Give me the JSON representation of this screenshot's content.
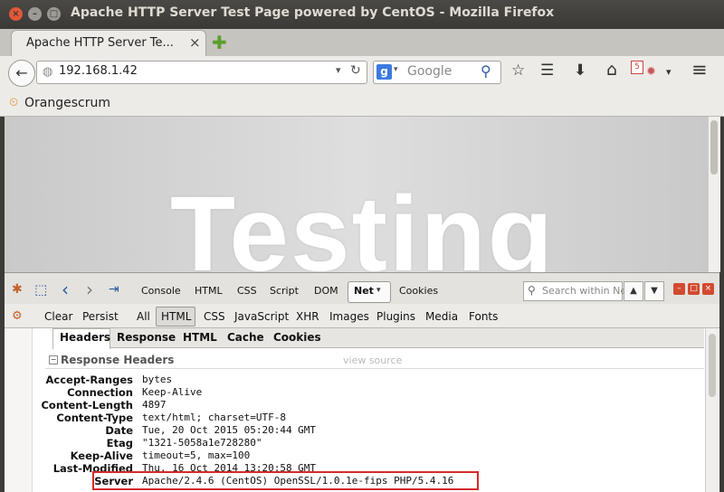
{
  "window": {
    "title": "Apache HTTP Server Test Page powered by CentOS - Mozilla Firefox",
    "controls": {
      "close": "×",
      "minimize": "–",
      "maximize": "□"
    }
  },
  "tabs": [
    {
      "label": "Apache HTTP Server Te...",
      "close": "×",
      "active": true
    }
  ],
  "new_tab": "✚",
  "navbar": {
    "back": "←",
    "url": "192.168.1.42",
    "url_dropdown": "▾",
    "reload": "↻",
    "search_engine_logo": "g",
    "search_engine_dropdown": "▾",
    "search_placeholder": "Google",
    "search_go": "⚲",
    "icons": [
      "star-icon",
      "reading-list-icon",
      "download-icon",
      "home-icon",
      "addon-icon",
      "menu-icon"
    ],
    "addon_badge": "5",
    "star": "☆",
    "reading_list": "☰",
    "download": "⬇",
    "home": "⌂",
    "addon": "▾",
    "menu": "≡"
  },
  "bookmarks": [
    {
      "label": "Orangescrum",
      "icon": "⏲"
    }
  ],
  "page": {
    "heading": "Testing"
  },
  "firebug": {
    "toolbar_glyphs": {
      "bug": "✱",
      "inspect": "⬚",
      "back": "‹",
      "forward": "›",
      "cmd": "⇥"
    },
    "tabs": [
      "Console",
      "HTML",
      "CSS",
      "Script",
      "DOM",
      "Net",
      "Cookies"
    ],
    "net_dropdown": "▾",
    "search_placeholder": "Search within Ne",
    "search_icon": "⚲",
    "nav_up": "▲",
    "nav_down": "▼",
    "win_buttons": [
      "–",
      "□",
      "×"
    ],
    "net_actions": {
      "clear": "Clear",
      "persist": "Persist"
    },
    "filters": [
      "All",
      "HTML",
      "CSS",
      "JavaScript",
      "XHR",
      "Images",
      "Plugins",
      "Media",
      "Fonts"
    ],
    "active_filter": "HTML",
    "detail_tabs": [
      "Headers",
      "Response",
      "HTML",
      "Cache",
      "Cookies"
    ],
    "active_detail_tab": "Headers",
    "section": {
      "toggle": "−",
      "title": "Response Headers",
      "view_source": "view source"
    },
    "headers": [
      {
        "name": "Accept-Ranges",
        "value": "bytes"
      },
      {
        "name": "Connection",
        "value": "Keep-Alive"
      },
      {
        "name": "Content-Length",
        "value": "4897"
      },
      {
        "name": "Content-Type",
        "value": "text/html; charset=UTF-8"
      },
      {
        "name": "Date",
        "value": "Tue, 20 Oct 2015 05:20:44 GMT"
      },
      {
        "name": "Etag",
        "value": "\"1321-5058a1e728280\""
      },
      {
        "name": "Keep-Alive",
        "value": "timeout=5, max=100"
      },
      {
        "name": "Last-Modified",
        "value": "Thu, 16 Oct 2014 13:20:58 GMT"
      },
      {
        "name": "Server",
        "value": "Apache/2.4.6 (CentOS) OpenSSL/1.0.1e-fips PHP/5.4.16"
      }
    ]
  },
  "colors": {
    "highlight_border": "#d62b2b",
    "titlebar": "#3c3b37",
    "close_button": "#e0583b"
  }
}
